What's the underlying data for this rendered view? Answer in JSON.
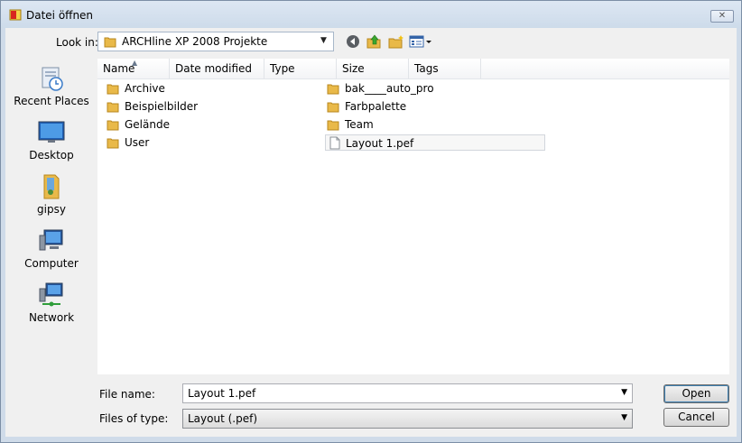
{
  "window": {
    "title": "Datei öffnen",
    "close_glyph": "✕"
  },
  "toolbar": {
    "look_in_label": "Look in:",
    "look_in_value": "ARCHline XP 2008 Projekte",
    "icons": [
      "back-icon",
      "up-folder-icon",
      "new-folder-icon",
      "view-menu-icon"
    ]
  },
  "places": [
    {
      "label": "Recent Places",
      "icon": "recent-places-icon"
    },
    {
      "label": "Desktop",
      "icon": "desktop-icon"
    },
    {
      "label": "gipsy",
      "icon": "user-folder-icon"
    },
    {
      "label": "Computer",
      "icon": "computer-icon"
    },
    {
      "label": "Network",
      "icon": "network-icon"
    }
  ],
  "columns": [
    "Name",
    "Date modified",
    "Type",
    "Size",
    "Tags"
  ],
  "items": [
    {
      "name": "Archive",
      "kind": "folder"
    },
    {
      "name": "Beispielbilder",
      "kind": "folder"
    },
    {
      "name": "Gelände",
      "kind": "folder"
    },
    {
      "name": "User",
      "kind": "folder"
    },
    {
      "name": "bak____auto_pro",
      "kind": "folder"
    },
    {
      "name": "Farbpalette",
      "kind": "folder"
    },
    {
      "name": "Team",
      "kind": "folder"
    },
    {
      "name": "Layout 1.pef",
      "kind": "file",
      "selected": true
    }
  ],
  "filename": {
    "label": "File name:",
    "value": "Layout 1.pef"
  },
  "filetype": {
    "label": "Files of type:",
    "value": "Layout (.pef)"
  },
  "buttons": {
    "open": "Open",
    "cancel": "Cancel"
  },
  "colors": {
    "folder": "#e9b949",
    "selection_border": "#d2d6dc",
    "window_frame": "#cfdbe9"
  }
}
